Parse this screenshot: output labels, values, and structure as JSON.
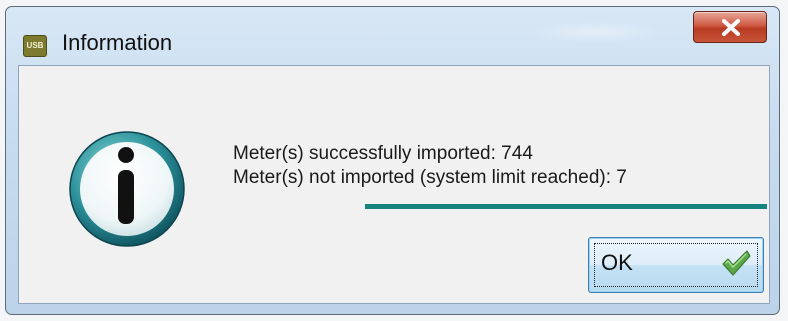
{
  "window": {
    "title": "Information",
    "app_icon_text": "USB"
  },
  "message": {
    "line1": "Meter(s) successfully imported: 744",
    "line2": "Meter(s) not imported (system limit reached): 7"
  },
  "buttons": {
    "ok_label": "OK"
  },
  "icons": {
    "app": "usb-app-icon",
    "close": "close-icon",
    "info": "info-icon",
    "check": "check-icon"
  },
  "colors": {
    "accent_teal": "#17837f",
    "close_red": "#c75539",
    "check_green": "#5aa84a"
  }
}
